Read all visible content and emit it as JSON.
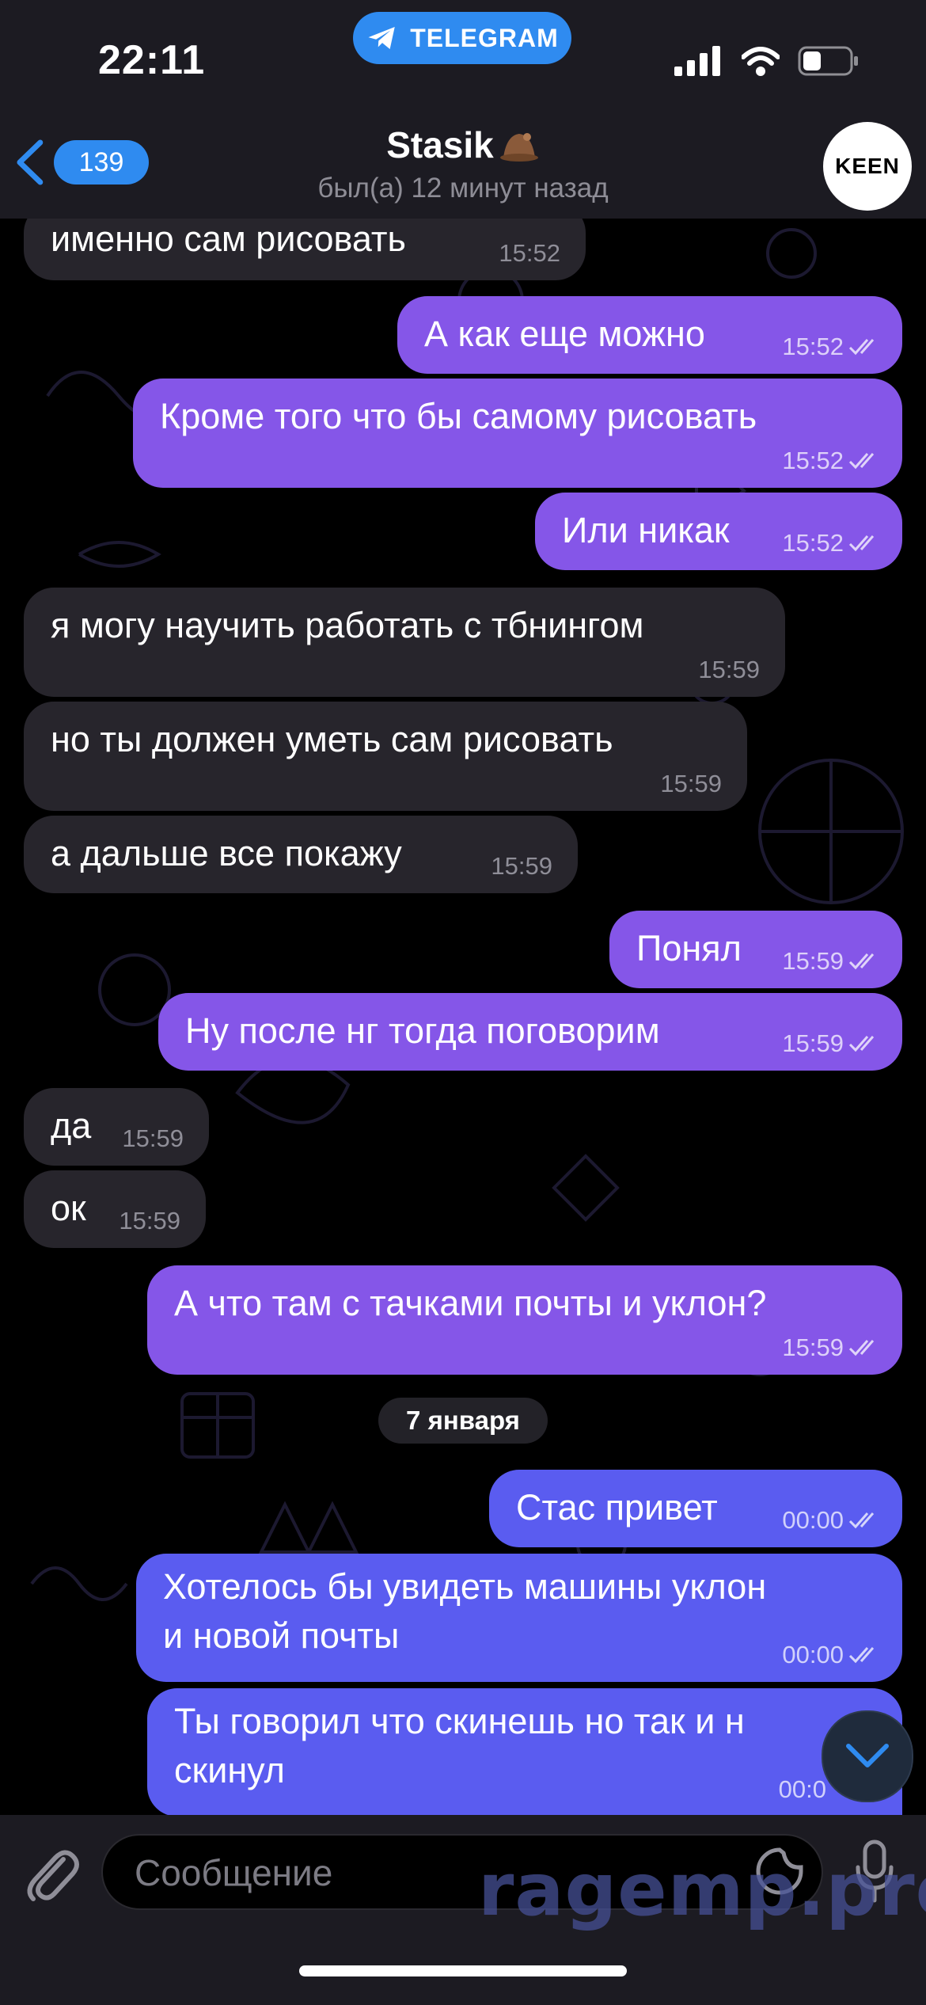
{
  "status_bar": {
    "time": "22:11",
    "app_pill": "TELEGRAM",
    "icons": [
      "signal-icon",
      "wifi-icon",
      "battery-icon"
    ]
  },
  "header": {
    "back_badge": "139",
    "title": "Stasik",
    "subtitle": "был(а) 12 минут назад",
    "avatar_text": "KEEN"
  },
  "messages": [
    {
      "dir": "in",
      "text": "именно сам рисовать",
      "time": "15:52"
    },
    {
      "dir": "out",
      "text": "А как еще можно",
      "time": "15:52"
    },
    {
      "dir": "out",
      "text": "Кроме того что бы самому рисовать",
      "time": "15:52"
    },
    {
      "dir": "out",
      "text": "Или никак",
      "time": "15:52"
    },
    {
      "dir": "in",
      "text": "я могу научить работать с тбнингом",
      "time": "15:59"
    },
    {
      "dir": "in",
      "text": "но ты должен уметь сам рисовать",
      "time": "15:59"
    },
    {
      "dir": "in",
      "text": "а дальше все покажу",
      "time": "15:59"
    },
    {
      "dir": "out",
      "text": "Понял",
      "time": "15:59"
    },
    {
      "dir": "out",
      "text": "Ну после нг тогда поговорим",
      "time": "15:59"
    },
    {
      "dir": "in",
      "text": "да",
      "time": "15:59"
    },
    {
      "dir": "in",
      "text": "ок",
      "time": "15:59"
    },
    {
      "dir": "out",
      "text": "А что там с тачками почты и уклон?",
      "time": "15:59"
    },
    {
      "dir": "out",
      "text": "Стас привет",
      "time": "00:00"
    },
    {
      "dir": "out",
      "text": "Хотелось бы увидеть машины уклон",
      "text2": "и новой почты",
      "time": "00:00"
    },
    {
      "dir": "out",
      "text": "Ты говорил что скинешь но так и н",
      "text2": "скинул",
      "time": "00:0"
    }
  ],
  "date_separator": "7 января",
  "input": {
    "placeholder": "Сообщение"
  },
  "watermark": "ragemp.pro",
  "colors": {
    "outgoing_bubble": "#8556e8",
    "outgoing_bubble_bottom": "#5a5cf0",
    "incoming_bubble": "#27252c",
    "accent": "#2f8bf0"
  }
}
